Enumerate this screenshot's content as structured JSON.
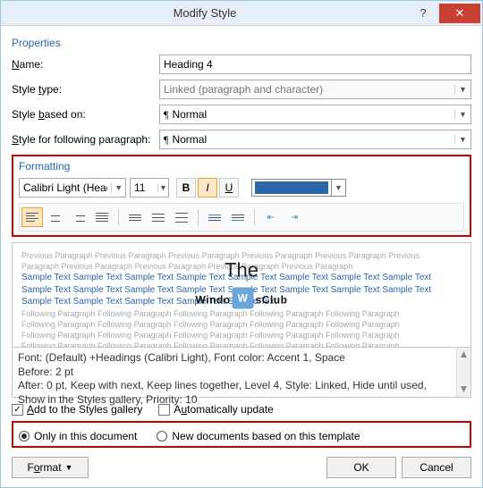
{
  "title": "Modify Style",
  "sections": {
    "properties": "Properties",
    "formatting": "Formatting"
  },
  "fields": {
    "name_label": "Name:",
    "name_value": "Heading 4",
    "styletype_label": "Style type:",
    "styletype_value": "Linked (paragraph and character)",
    "basedon_label": "Style based on:",
    "basedon_value": "Normal",
    "following_label": "Style for following paragraph:",
    "following_value": "Normal"
  },
  "formatting": {
    "font": "Calibri Light (Head",
    "size": "11",
    "bold": "B",
    "italic": "I",
    "underline": "U",
    "color": "#2a66a8"
  },
  "preview": {
    "prev": "Previous Paragraph Previous Paragraph Previous Paragraph Previous Paragraph Previous Paragraph Previous",
    "prev2": "Paragraph Previous Paragraph Previous Paragraph Previous Paragraph Previous Paragraph",
    "sample1": "Sample Text Sample Text Sample Text Sample Text Sample Text Sample Text Sample Text Sample Text",
    "sample2": "Sample Text Sample Text Sample Text Sample Text Sample Text Sample Text Sample Text Sample Text",
    "sample3": "Sample Text Sample Text Sample Text Sample Text Sample Text",
    "foll": "Following Paragraph Following Paragraph Following Paragraph Following Paragraph Following Paragraph"
  },
  "watermark": {
    "line1": "The",
    "line2a": "Windo",
    "line2b": "sClub"
  },
  "description": {
    "l1": "Font: (Default) +Headings (Calibri Light), Font color: Accent 1, Space",
    "l2": "   Before:  2 pt",
    "l3": "   After:  0 pt, Keep with next, Keep lines together, Level 4, Style: Linked, Hide until used,",
    "l4": "Show in the Styles gallery, Priority: 10"
  },
  "checks": {
    "addgallery": "Add to the Styles gallery",
    "autoupdate": "Automatically update"
  },
  "radios": {
    "thisdoc": "Only in this document",
    "template": "New documents based on this template"
  },
  "buttons": {
    "format": "Format",
    "ok": "OK",
    "cancel": "Cancel"
  }
}
